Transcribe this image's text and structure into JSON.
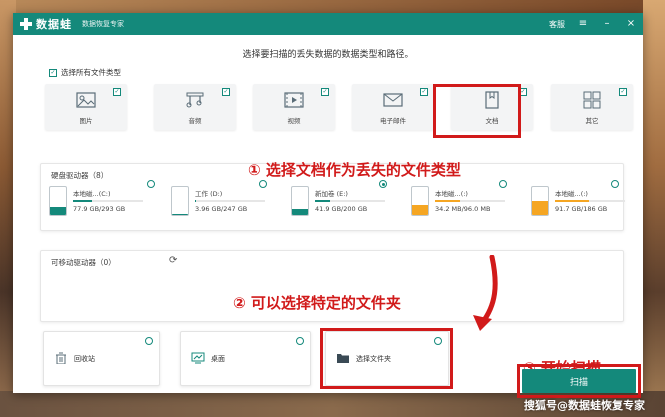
{
  "app": {
    "logo_text": "数据蛙",
    "subtitle": "数据恢复专家",
    "support_link": "客服"
  },
  "heading": "选择要扫描的丢失数据的数据类型和路径。",
  "select_all_label": "选择所有文件类型",
  "file_types": [
    {
      "label": "图片",
      "icon": "image-icon",
      "checked": true
    },
    {
      "label": "音频",
      "icon": "music-icon",
      "checked": true
    },
    {
      "label": "视频",
      "icon": "video-icon",
      "checked": true
    },
    {
      "label": "电子邮件",
      "icon": "email-icon",
      "checked": true
    },
    {
      "label": "文档",
      "icon": "document-icon",
      "checked": true
    },
    {
      "label": "其它",
      "icon": "other-icon",
      "checked": true
    }
  ],
  "hard_drives": {
    "title": "硬盘驱动器（8）",
    "drives": [
      {
        "name": "本地磁...(C:)",
        "size": "77.9 GB/293 GB",
        "used_fraction": 0.27,
        "color": "#14897b",
        "selected": false
      },
      {
        "name": "工作 (D:)",
        "size": "3.96 GB/247 GB",
        "used_fraction": 0.02,
        "color": "#14897b",
        "selected": false
      },
      {
        "name": "新加卷 (E:)",
        "size": "41.9 GB/200 GB",
        "used_fraction": 0.21,
        "color": "#14897b",
        "selected": true
      },
      {
        "name": "本地磁...(:)",
        "size": "34.2 MB/96.0 MB",
        "used_fraction": 0.36,
        "color": "#f5a623",
        "selected": false
      },
      {
        "name": "本地磁...(:)",
        "size": "91.7 GB/186 GB",
        "used_fraction": 0.49,
        "color": "#f5a623",
        "selected": false
      }
    ]
  },
  "removable": {
    "title": "可移动驱动器（0）"
  },
  "locations": [
    {
      "label": "回收站",
      "icon": "recycle-bin-icon"
    },
    {
      "label": "桌面",
      "icon": "desktop-icon"
    },
    {
      "label": "选择文件夹",
      "icon": "folder-icon"
    }
  ],
  "annotations": {
    "step1": "① 选择文档作为丢失的文件类型",
    "step2": "② 可以选择特定的文件夹",
    "step3": "③ 开始扫描"
  },
  "scan_button": "扫描",
  "watermark": "搜狐号@数据蛙恢复专家",
  "colors": {
    "accent": "#14897b",
    "annotation": "#d11a1a",
    "warning_fill": "#f5a623"
  }
}
